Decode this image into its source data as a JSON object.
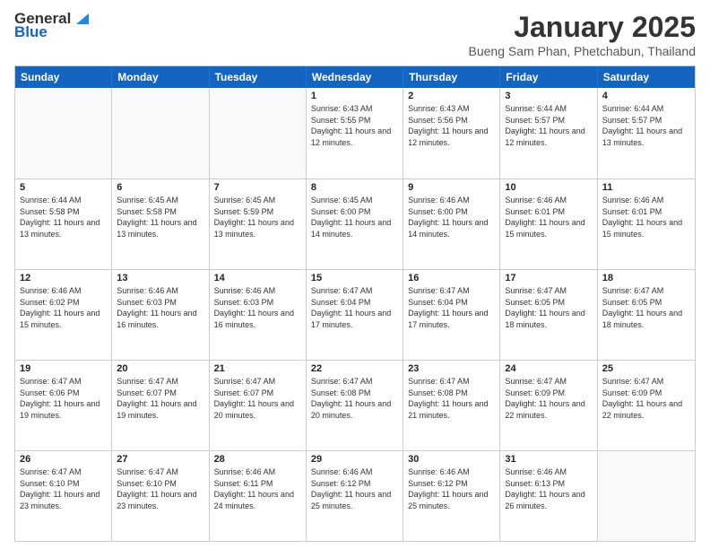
{
  "header": {
    "logo_general": "General",
    "logo_blue": "Blue",
    "month_title": "January 2025",
    "location": "Bueng Sam Phan, Phetchabun, Thailand"
  },
  "weekdays": [
    "Sunday",
    "Monday",
    "Tuesday",
    "Wednesday",
    "Thursday",
    "Friday",
    "Saturday"
  ],
  "weeks": [
    [
      {
        "day": "",
        "sunrise": "",
        "sunset": "",
        "daylight": ""
      },
      {
        "day": "",
        "sunrise": "",
        "sunset": "",
        "daylight": ""
      },
      {
        "day": "",
        "sunrise": "",
        "sunset": "",
        "daylight": ""
      },
      {
        "day": "1",
        "sunrise": "Sunrise: 6:43 AM",
        "sunset": "Sunset: 5:55 PM",
        "daylight": "Daylight: 11 hours and 12 minutes."
      },
      {
        "day": "2",
        "sunrise": "Sunrise: 6:43 AM",
        "sunset": "Sunset: 5:56 PM",
        "daylight": "Daylight: 11 hours and 12 minutes."
      },
      {
        "day": "3",
        "sunrise": "Sunrise: 6:44 AM",
        "sunset": "Sunset: 5:57 PM",
        "daylight": "Daylight: 11 hours and 12 minutes."
      },
      {
        "day": "4",
        "sunrise": "Sunrise: 6:44 AM",
        "sunset": "Sunset: 5:57 PM",
        "daylight": "Daylight: 11 hours and 13 minutes."
      }
    ],
    [
      {
        "day": "5",
        "sunrise": "Sunrise: 6:44 AM",
        "sunset": "Sunset: 5:58 PM",
        "daylight": "Daylight: 11 hours and 13 minutes."
      },
      {
        "day": "6",
        "sunrise": "Sunrise: 6:45 AM",
        "sunset": "Sunset: 5:58 PM",
        "daylight": "Daylight: 11 hours and 13 minutes."
      },
      {
        "day": "7",
        "sunrise": "Sunrise: 6:45 AM",
        "sunset": "Sunset: 5:59 PM",
        "daylight": "Daylight: 11 hours and 13 minutes."
      },
      {
        "day": "8",
        "sunrise": "Sunrise: 6:45 AM",
        "sunset": "Sunset: 6:00 PM",
        "daylight": "Daylight: 11 hours and 14 minutes."
      },
      {
        "day": "9",
        "sunrise": "Sunrise: 6:46 AM",
        "sunset": "Sunset: 6:00 PM",
        "daylight": "Daylight: 11 hours and 14 minutes."
      },
      {
        "day": "10",
        "sunrise": "Sunrise: 6:46 AM",
        "sunset": "Sunset: 6:01 PM",
        "daylight": "Daylight: 11 hours and 15 minutes."
      },
      {
        "day": "11",
        "sunrise": "Sunrise: 6:46 AM",
        "sunset": "Sunset: 6:01 PM",
        "daylight": "Daylight: 11 hours and 15 minutes."
      }
    ],
    [
      {
        "day": "12",
        "sunrise": "Sunrise: 6:46 AM",
        "sunset": "Sunset: 6:02 PM",
        "daylight": "Daylight: 11 hours and 15 minutes."
      },
      {
        "day": "13",
        "sunrise": "Sunrise: 6:46 AM",
        "sunset": "Sunset: 6:03 PM",
        "daylight": "Daylight: 11 hours and 16 minutes."
      },
      {
        "day": "14",
        "sunrise": "Sunrise: 6:46 AM",
        "sunset": "Sunset: 6:03 PM",
        "daylight": "Daylight: 11 hours and 16 minutes."
      },
      {
        "day": "15",
        "sunrise": "Sunrise: 6:47 AM",
        "sunset": "Sunset: 6:04 PM",
        "daylight": "Daylight: 11 hours and 17 minutes."
      },
      {
        "day": "16",
        "sunrise": "Sunrise: 6:47 AM",
        "sunset": "Sunset: 6:04 PM",
        "daylight": "Daylight: 11 hours and 17 minutes."
      },
      {
        "day": "17",
        "sunrise": "Sunrise: 6:47 AM",
        "sunset": "Sunset: 6:05 PM",
        "daylight": "Daylight: 11 hours and 18 minutes."
      },
      {
        "day": "18",
        "sunrise": "Sunrise: 6:47 AM",
        "sunset": "Sunset: 6:05 PM",
        "daylight": "Daylight: 11 hours and 18 minutes."
      }
    ],
    [
      {
        "day": "19",
        "sunrise": "Sunrise: 6:47 AM",
        "sunset": "Sunset: 6:06 PM",
        "daylight": "Daylight: 11 hours and 19 minutes."
      },
      {
        "day": "20",
        "sunrise": "Sunrise: 6:47 AM",
        "sunset": "Sunset: 6:07 PM",
        "daylight": "Daylight: 11 hours and 19 minutes."
      },
      {
        "day": "21",
        "sunrise": "Sunrise: 6:47 AM",
        "sunset": "Sunset: 6:07 PM",
        "daylight": "Daylight: 11 hours and 20 minutes."
      },
      {
        "day": "22",
        "sunrise": "Sunrise: 6:47 AM",
        "sunset": "Sunset: 6:08 PM",
        "daylight": "Daylight: 11 hours and 20 minutes."
      },
      {
        "day": "23",
        "sunrise": "Sunrise: 6:47 AM",
        "sunset": "Sunset: 6:08 PM",
        "daylight": "Daylight: 11 hours and 21 minutes."
      },
      {
        "day": "24",
        "sunrise": "Sunrise: 6:47 AM",
        "sunset": "Sunset: 6:09 PM",
        "daylight": "Daylight: 11 hours and 22 minutes."
      },
      {
        "day": "25",
        "sunrise": "Sunrise: 6:47 AM",
        "sunset": "Sunset: 6:09 PM",
        "daylight": "Daylight: 11 hours and 22 minutes."
      }
    ],
    [
      {
        "day": "26",
        "sunrise": "Sunrise: 6:47 AM",
        "sunset": "Sunset: 6:10 PM",
        "daylight": "Daylight: 11 hours and 23 minutes."
      },
      {
        "day": "27",
        "sunrise": "Sunrise: 6:47 AM",
        "sunset": "Sunset: 6:10 PM",
        "daylight": "Daylight: 11 hours and 23 minutes."
      },
      {
        "day": "28",
        "sunrise": "Sunrise: 6:46 AM",
        "sunset": "Sunset: 6:11 PM",
        "daylight": "Daylight: 11 hours and 24 minutes."
      },
      {
        "day": "29",
        "sunrise": "Sunrise: 6:46 AM",
        "sunset": "Sunset: 6:12 PM",
        "daylight": "Daylight: 11 hours and 25 minutes."
      },
      {
        "day": "30",
        "sunrise": "Sunrise: 6:46 AM",
        "sunset": "Sunset: 6:12 PM",
        "daylight": "Daylight: 11 hours and 25 minutes."
      },
      {
        "day": "31",
        "sunrise": "Sunrise: 6:46 AM",
        "sunset": "Sunset: 6:13 PM",
        "daylight": "Daylight: 11 hours and 26 minutes."
      },
      {
        "day": "",
        "sunrise": "",
        "sunset": "",
        "daylight": ""
      }
    ]
  ]
}
